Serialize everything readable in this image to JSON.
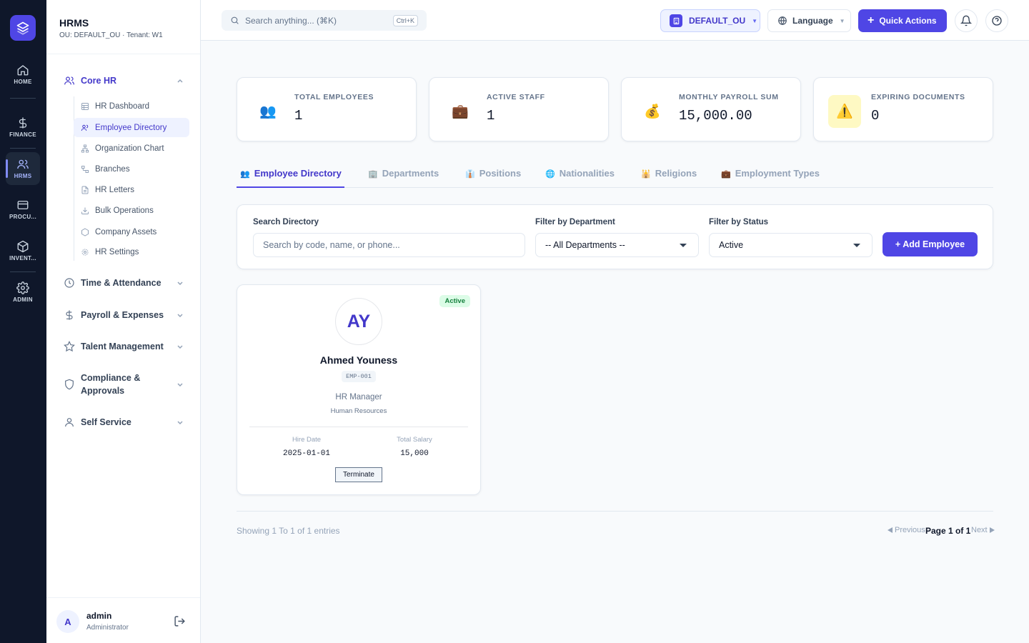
{
  "rail": {
    "items": [
      {
        "label": "HOME"
      },
      {
        "label": "FINANCE"
      },
      {
        "label": "HRMS"
      },
      {
        "label": "PROCU..."
      },
      {
        "label": "INVENT..."
      },
      {
        "label": "ADMIN"
      }
    ]
  },
  "sidebar": {
    "title": "HRMS",
    "subtitle": "OU: DEFAULT_OU · Tenant: W1",
    "groups": [
      {
        "label": "Core HR"
      },
      {
        "label": "Time & Attendance"
      },
      {
        "label": "Payroll & Expenses"
      },
      {
        "label": "Talent Management"
      },
      {
        "label": "Compliance &"
      },
      {
        "label": "Approvals"
      },
      {
        "label": "Self Service"
      }
    ],
    "core_items": [
      {
        "label": "HR Dashboard"
      },
      {
        "label": "Employee Directory"
      },
      {
        "label": "Organization Chart"
      },
      {
        "label": "Branches"
      },
      {
        "label": "HR Letters"
      },
      {
        "label": "Bulk Operations"
      },
      {
        "label": "Company Assets"
      },
      {
        "label": "HR Settings"
      }
    ],
    "user": {
      "initial": "A",
      "name": "admin",
      "role": "Administrator"
    }
  },
  "topbar": {
    "search_placeholder": "Search anything... (⌘K)",
    "shortcut": "Ctrl+K",
    "ou": "DEFAULT_OU",
    "language": "Language",
    "quick_actions": "Quick Actions"
  },
  "kpis": [
    {
      "label": "TOTAL EMPLOYEES",
      "value": "1",
      "icon": "👥"
    },
    {
      "label": "ACTIVE STAFF",
      "value": "1",
      "icon": "💼"
    },
    {
      "label": "MONTHLY PAYROLL SUM",
      "value": "15,000.00",
      "icon": "💰"
    },
    {
      "label": "EXPIRING DOCUMENTS",
      "value": "0",
      "icon": "⚠️"
    }
  ],
  "tabs": [
    {
      "label": "Employee Directory",
      "icon": "👥"
    },
    {
      "label": "Departments",
      "icon": "🏢"
    },
    {
      "label": "Positions",
      "icon": "👔"
    },
    {
      "label": "Nationalities",
      "icon": "🌐"
    },
    {
      "label": "Religions",
      "icon": "🕌"
    },
    {
      "label": "Employment Types",
      "icon": "💼"
    }
  ],
  "filters": {
    "search_label": "Search Directory",
    "search_placeholder": "Search by code, name, or phone...",
    "dept_label": "Filter by Department",
    "dept_value": "-- All Departments --",
    "status_label": "Filter by Status",
    "status_value": "Active",
    "add_button": "+ Add Employee"
  },
  "employee": {
    "status": "Active",
    "initials": "AY",
    "name": "Ahmed Youness",
    "code": "EMP-001",
    "position": "HR Manager",
    "department": "Human Resources",
    "hire_label": "Hire Date",
    "hire_date": "2025-01-01",
    "salary_label": "Total Salary",
    "salary": "15,000",
    "terminate": "Terminate"
  },
  "pagination": {
    "showing": "Showing 1 To 1 of 1 entries",
    "prev": "Previous",
    "page": "Page 1 of 1",
    "next": "Next"
  },
  "colors": {
    "primary": "#4f46e5",
    "rail": "#0f172a",
    "success": "#15803d"
  }
}
